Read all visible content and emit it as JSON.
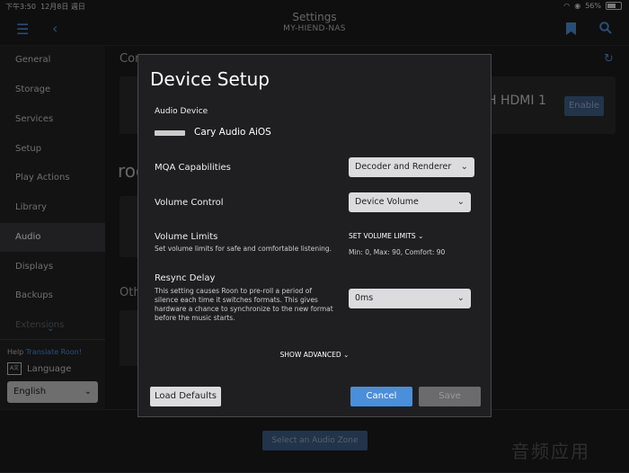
{
  "status": {
    "time": "下午3:50",
    "date": "12月8日 週日",
    "battery": "56%"
  },
  "header": {
    "title": "Settings",
    "subtitle": "MY-HIEND-NAS"
  },
  "sidebar": {
    "items": [
      {
        "label": "General"
      },
      {
        "label": "Storage"
      },
      {
        "label": "Services"
      },
      {
        "label": "Setup"
      },
      {
        "label": "Play Actions"
      },
      {
        "label": "Library"
      },
      {
        "label": "Audio"
      },
      {
        "label": "Displays"
      },
      {
        "label": "Backups"
      },
      {
        "label": "Extensions"
      }
    ],
    "help_prefix": "Help",
    "help_link": "Translate Roon!",
    "language_label": "Language",
    "language_value": "English"
  },
  "background": {
    "section1": "Con",
    "section2": "roo",
    "section3": "Oth",
    "hdmi_text": "H HDMI 1",
    "enable_button": "Enable",
    "zone_button": "Select an Audio Zone",
    "watermark": "音频应用"
  },
  "dialog": {
    "title": "Device Setup",
    "audio_device_label": "Audio Device",
    "device_name": "Cary Audio AiOS",
    "mqa": {
      "label": "MQA Capabilities",
      "value": "Decoder and Renderer"
    },
    "volume_control": {
      "label": "Volume Control",
      "value": "Device Volume"
    },
    "volume_limits": {
      "label": "Volume Limits",
      "description": "Set volume limits for safe and comfortable listening.",
      "link": "SET VOLUME LIMITS",
      "info": "Min: 0, Max: 90, Comfort: 90"
    },
    "resync_delay": {
      "label": "Resync Delay",
      "description_lines": [
        "This setting causes Roon to pre-roll a period of",
        "silence each time it switches formats. This gives",
        "hardware a chance to synchronize to the new format",
        "before the music starts."
      ],
      "value": "0ms"
    },
    "show_advanced": "SHOW ADVANCED",
    "load_defaults": "Load Defaults",
    "cancel": "Cancel",
    "save": "Save"
  }
}
